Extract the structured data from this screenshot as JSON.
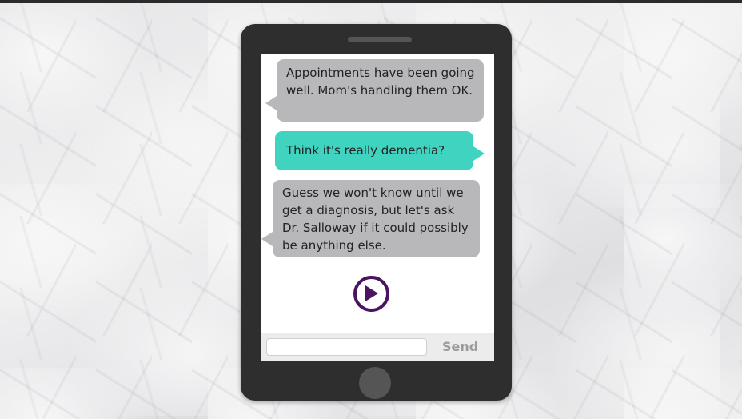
{
  "conversation": {
    "messages": [
      {
        "sender": "contact",
        "text": "Appointments have been going well. Mom's handling them OK."
      },
      {
        "sender": "user",
        "text": "Think it's really dementia?"
      },
      {
        "sender": "contact",
        "text": "Guess we won't know until we get a diagnosis, but let's ask Dr. Salloway if it could possibly be anything else."
      }
    ]
  },
  "controls": {
    "play_icon": "play-circle-icon",
    "input_value": "",
    "send_label": "Send"
  },
  "colors": {
    "incoming_bubble": "#b8b8ba",
    "outgoing_bubble": "#3fd3c0",
    "play_button": "#4b1463",
    "phone_body": "#2e2e2e"
  }
}
